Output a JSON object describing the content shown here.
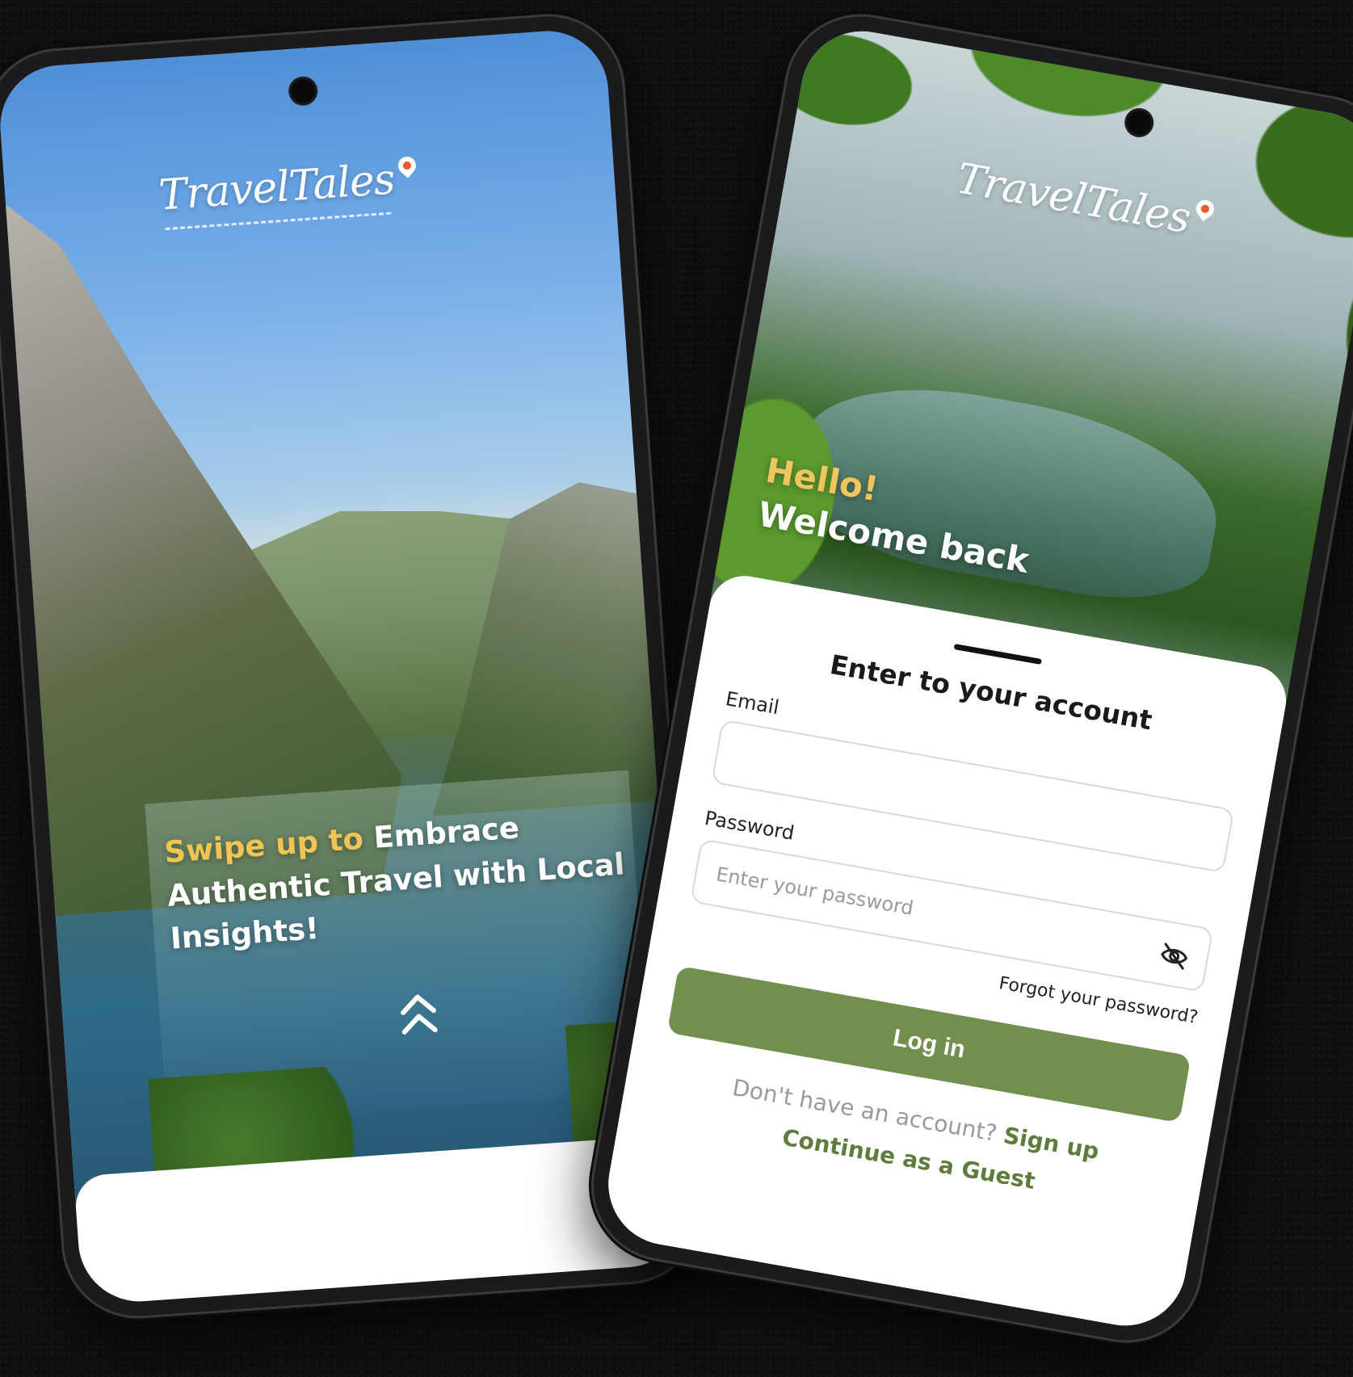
{
  "brand": {
    "logo_text": "TravelTales",
    "accent_color": "#f0c453",
    "primary_color": "#738f50"
  },
  "welcome_screen": {
    "tagline_accent": "Swipe up to",
    "tagline_rest": "Embrace Authentic Travel with Local Insights!",
    "swipe_icon": "double-chevron-up-icon"
  },
  "login_screen": {
    "greeting_line1": "Hello!",
    "greeting_line2": "Welcome back",
    "title": "Enter to your account",
    "email_label": "Email",
    "email_placeholder": "",
    "password_label": "Password",
    "password_placeholder": "Enter your password",
    "password_visibility_icon": "eye-off-icon",
    "forgot_password": "Forgot your password?",
    "login_button": "Log in",
    "no_account_text": "Don't have an account?",
    "signup_link": "Sign up",
    "guest_link": "Continue as a Guest"
  }
}
